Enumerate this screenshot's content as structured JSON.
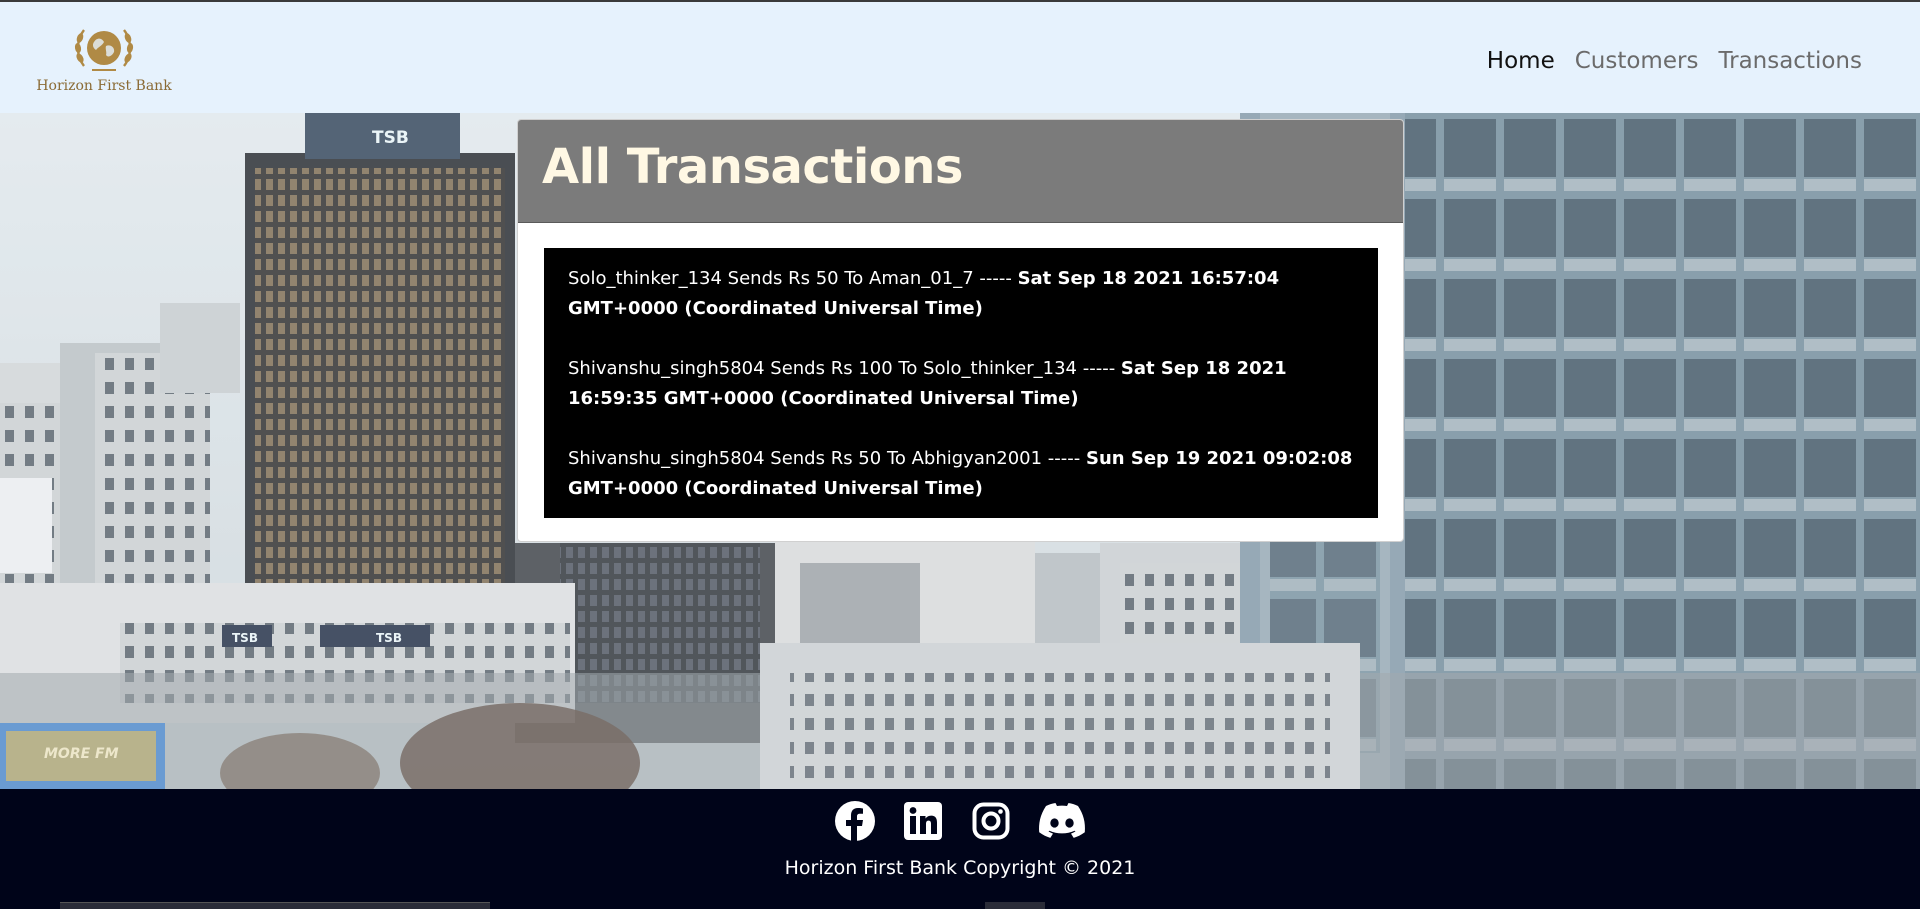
{
  "navbar": {
    "brand_name": "Horizon First Bank",
    "links": [
      {
        "label": "Home",
        "active": true
      },
      {
        "label": "Customers",
        "active": false
      },
      {
        "label": "Transactions",
        "active": false
      }
    ]
  },
  "main": {
    "title": "All Transactions",
    "transactions": [
      {
        "text": "Solo_thinker_134 Sends Rs 50 To Aman_01_7 ----- ",
        "date": "Sat Sep 18 2021 16:57:04 GMT+0000 (Coordinated Universal Time)"
      },
      {
        "text": "Shivanshu_singh5804 Sends Rs 100 To Solo_thinker_134 ----- ",
        "date": "Sat Sep 18 2021 16:59:35 GMT+0000 (Coordinated Universal Time)"
      },
      {
        "text": "Shivanshu_singh5804 Sends Rs 50 To Abhigyan2001 ----- ",
        "date": "Sun Sep 19 2021 09:02:08 GMT+0000 (Coordinated Universal Time)"
      }
    ]
  },
  "hero": {
    "signs": [
      "TSB",
      "TSB",
      "TSB",
      "MORE FM"
    ]
  },
  "footer": {
    "social_icons": [
      "facebook-icon",
      "linkedin-icon",
      "instagram-icon",
      "discord-icon"
    ],
    "copyright": "Horizon First Bank Copyright © 2021"
  },
  "colors": {
    "navbar_bg": "#e6f2fd",
    "card_header_bg": "#7b7b7b",
    "footer_bg": "#000419",
    "brand_gold": "#b08a45"
  }
}
